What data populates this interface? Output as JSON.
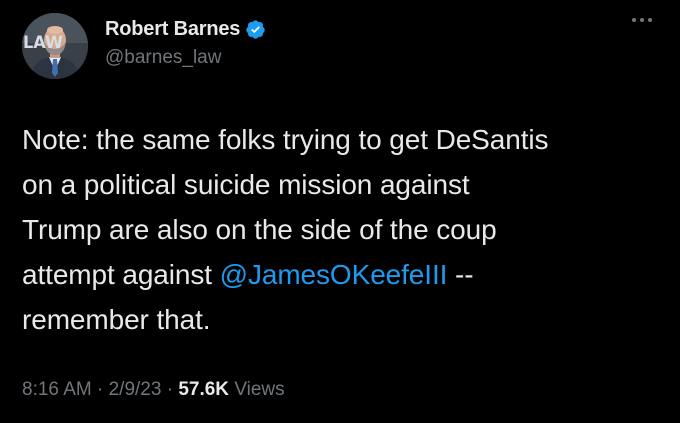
{
  "author": {
    "display_name": "Robert Barnes",
    "handle": "@barnes_law",
    "verified": true,
    "avatar_text": "LAW"
  },
  "tweet": {
    "lines": [
      "Note: the same folks trying to get DeSantis",
      "on a political suicide mission against",
      "Trump are also on the side of the coup",
      "attempt against ",
      "remember that."
    ],
    "mention": "@JamesOKeefeIII",
    "after_mention": " --"
  },
  "meta": {
    "time": "8:16 AM",
    "separator": "·",
    "date": "2/9/23",
    "views_count": "57.6K",
    "views_label": "Views"
  },
  "colors": {
    "background": "#000000",
    "text": "#e7e9ea",
    "muted": "#71767b",
    "accent": "#1d9bf0"
  },
  "icons": {
    "verified": "verified-badge-icon",
    "more": "more-options-icon"
  }
}
